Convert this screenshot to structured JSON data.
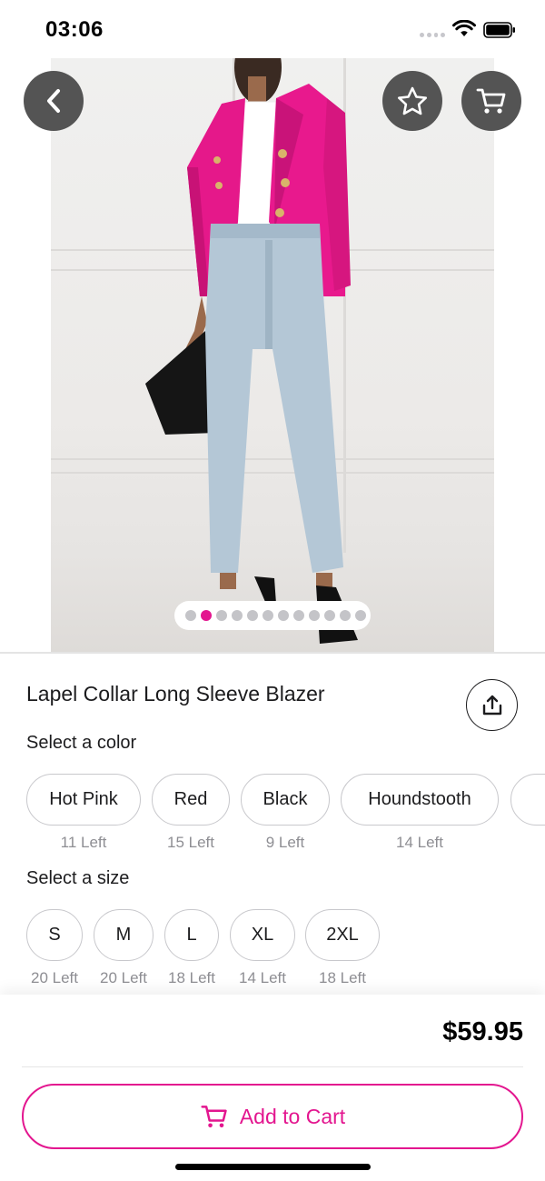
{
  "status_bar": {
    "time": "03:06"
  },
  "product": {
    "title": "Lapel Collar Long Sleeve Blazer",
    "price": "$59.95",
    "image_count": 12,
    "active_image_index": 1
  },
  "colors": {
    "label": "Select a color",
    "options": [
      {
        "name": "Hot Pink",
        "stock": "11 Left"
      },
      {
        "name": "Red",
        "stock": "15 Left"
      },
      {
        "name": "Black",
        "stock": "9 Left"
      },
      {
        "name": "Houndstooth",
        "stock": "14 Left"
      }
    ]
  },
  "sizes": {
    "label": "Select a size",
    "options": [
      {
        "name": "S",
        "stock": "20 Left"
      },
      {
        "name": "M",
        "stock": "20 Left"
      },
      {
        "name": "L",
        "stock": "18 Left"
      },
      {
        "name": "XL",
        "stock": "14 Left"
      },
      {
        "name": "2XL",
        "stock": "18 Left"
      }
    ]
  },
  "actions": {
    "add_to_cart": "Add to Cart"
  },
  "icons": {
    "back": "chevron-left-icon",
    "favorite": "star-icon",
    "cart": "cart-icon",
    "share": "share-icon"
  },
  "theme": {
    "accent": "#e3168f",
    "overlay_button": "#545454"
  }
}
